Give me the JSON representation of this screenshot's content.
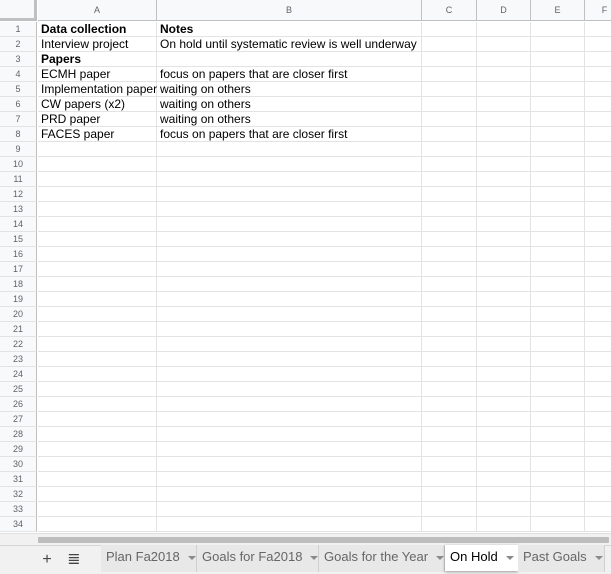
{
  "columns": [
    "A",
    "B",
    "C",
    "D",
    "E",
    "F"
  ],
  "row_numbers": [
    "1",
    "2",
    "3",
    "4",
    "5",
    "6",
    "7",
    "8",
    "9",
    "10",
    "11",
    "12",
    "13",
    "14",
    "15",
    "16",
    "17",
    "18",
    "19",
    "20",
    "21",
    "22",
    "23",
    "24",
    "25",
    "26",
    "27",
    "28",
    "29",
    "30",
    "31",
    "32",
    "33",
    "34"
  ],
  "rows": [
    {
      "a": "Data collection",
      "b": "Notes",
      "bold": true
    },
    {
      "a": "Interview project",
      "b": "On hold until systematic review is well underway",
      "bold": false
    },
    {
      "a": "Papers",
      "b": "",
      "bold": true
    },
    {
      "a": "ECMH paper",
      "b": "focus on papers that are closer first",
      "bold": false
    },
    {
      "a": "Implementation paper",
      "b": "waiting on others",
      "bold": false
    },
    {
      "a": "CW papers (x2)",
      "b": "waiting on others",
      "bold": false
    },
    {
      "a": "PRD paper",
      "b": "waiting on others",
      "bold": false
    },
    {
      "a": "FACES paper",
      "b": "focus on papers that are closer first",
      "bold": false
    }
  ],
  "toolbar": {
    "add_label": "+",
    "menu_label": "≣"
  },
  "tabs": [
    {
      "label": "Plan Fa2018",
      "active": false
    },
    {
      "label": "Goals for Fa2018",
      "active": false
    },
    {
      "label": "Goals for the Year",
      "active": false
    },
    {
      "label": "On Hold",
      "active": true
    },
    {
      "label": "Past Goals",
      "active": false
    }
  ]
}
